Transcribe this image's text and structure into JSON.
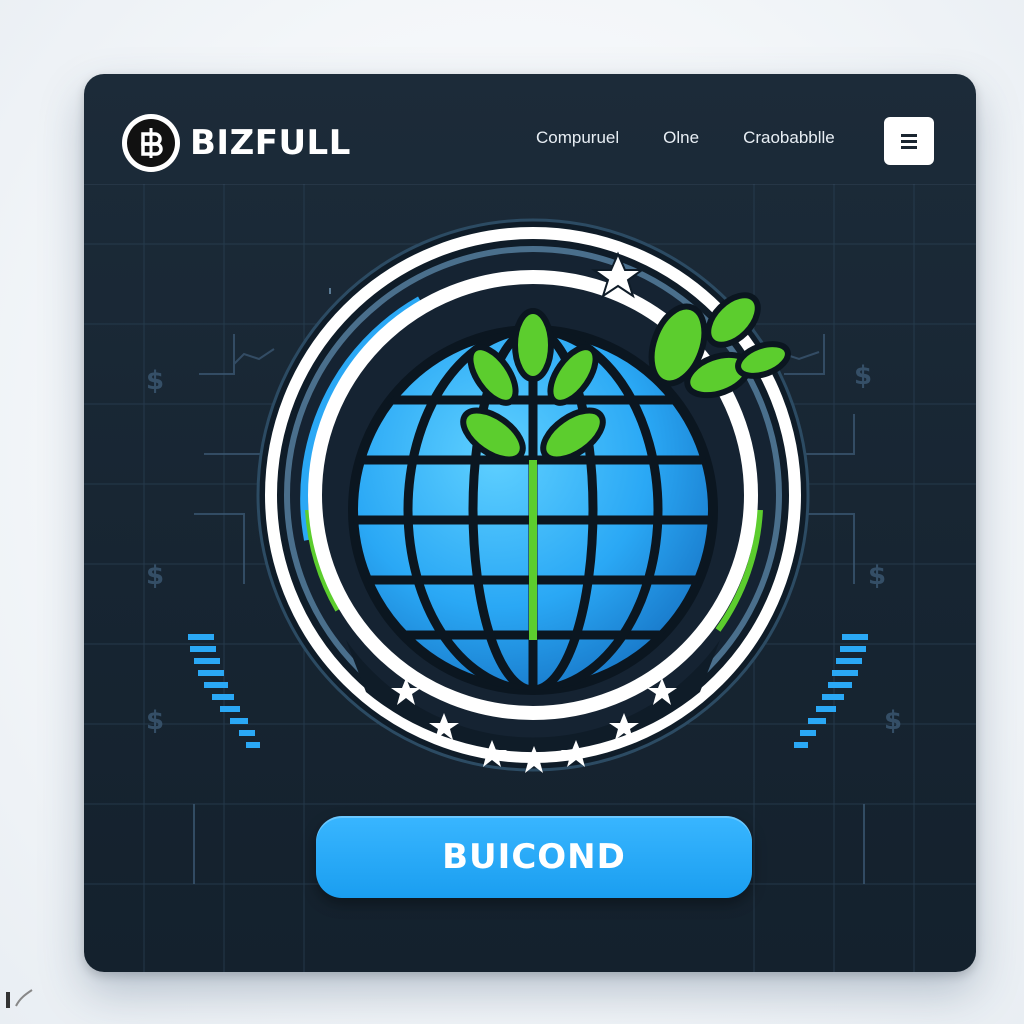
{
  "brand": {
    "name": "BIZFULL",
    "logo_icon": "dollar-b-icon"
  },
  "nav": {
    "items": [
      "Compuruel",
      "Olne",
      "Craobabblle"
    ]
  },
  "menu": {
    "icon": "hamburger-menu-icon"
  },
  "emblem": {
    "icon": "globe-with-plant-icon"
  },
  "cta": {
    "label": "BUICOND"
  },
  "colors": {
    "card_bg": "#172532",
    "accent_blue": "#2aa8f5",
    "accent_green": "#5ccd2e",
    "white": "#ffffff"
  }
}
